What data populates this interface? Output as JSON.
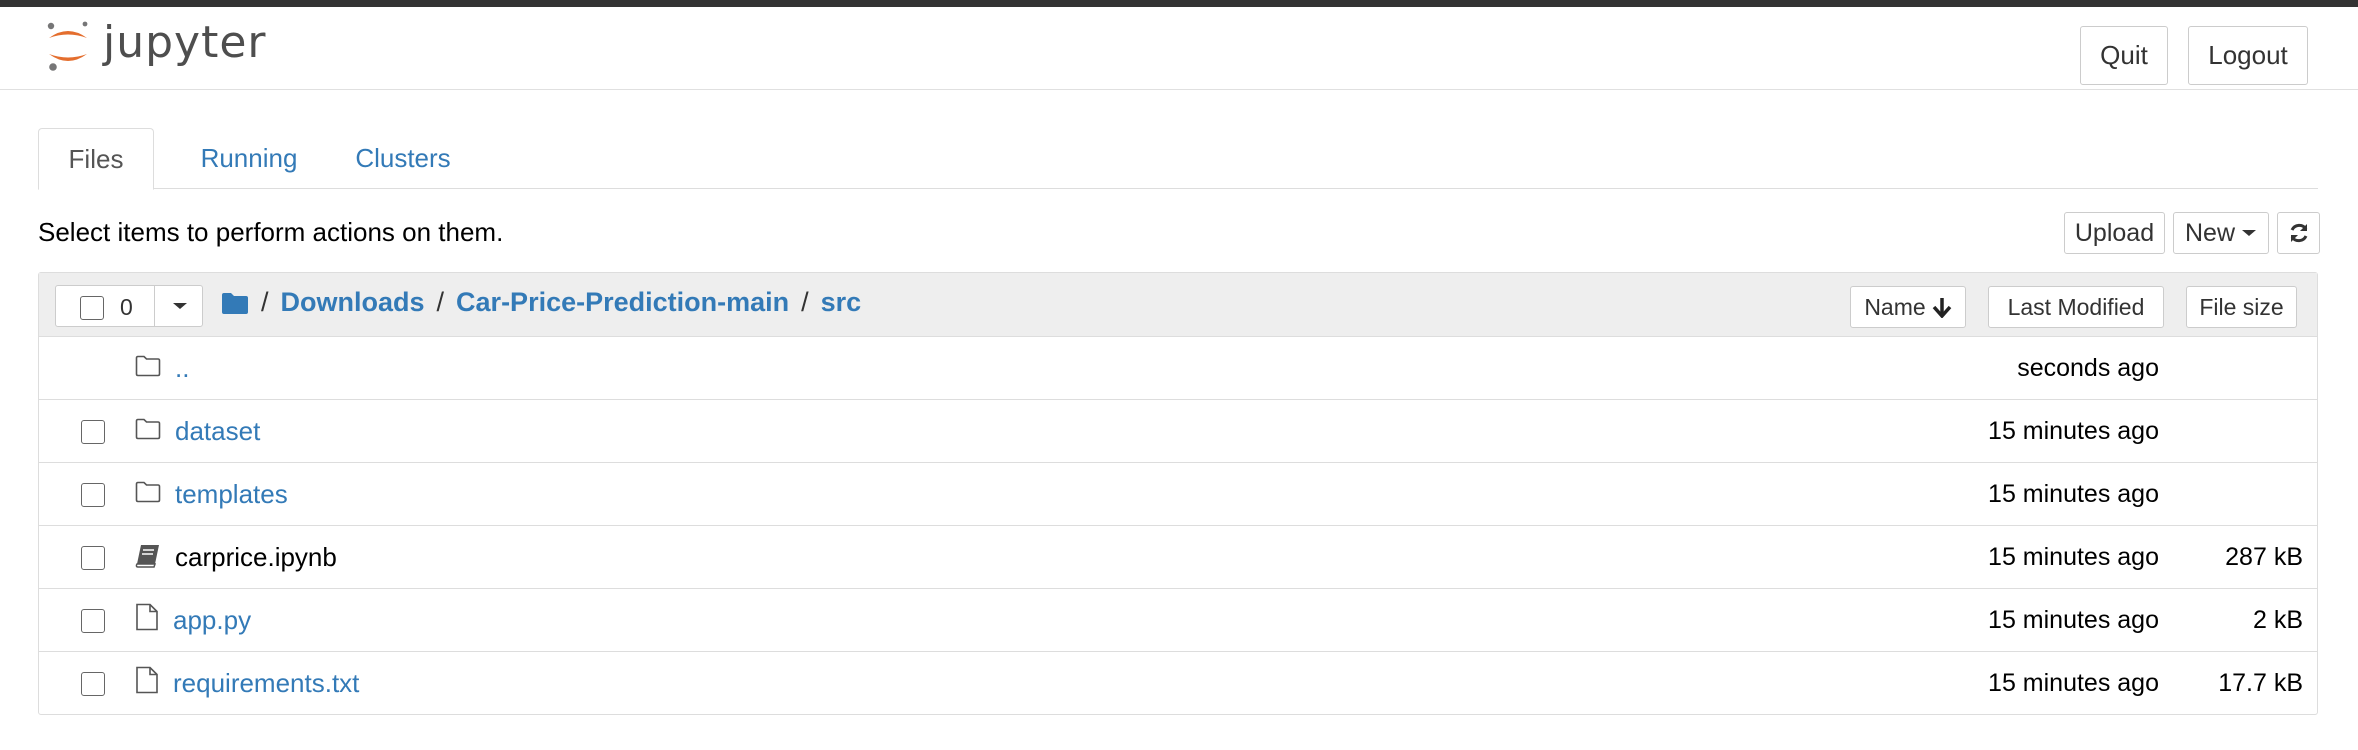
{
  "header": {
    "logo_text": "jupyter",
    "quit_label": "Quit",
    "logout_label": "Logout"
  },
  "tabs": [
    {
      "label": "Files",
      "active": true
    },
    {
      "label": "Running",
      "active": false
    },
    {
      "label": "Clusters",
      "active": false
    }
  ],
  "toolbar": {
    "hint": "Select items to perform actions on them.",
    "upload_label": "Upload",
    "new_label": "New",
    "refresh_icon": "refresh-icon"
  },
  "list_header": {
    "selected_count": "0",
    "breadcrumb": [
      "Downloads",
      "Car-Price-Prediction-main",
      "src"
    ],
    "sort_name": "Name",
    "sort_modified": "Last Modified",
    "sort_size": "File size"
  },
  "files": [
    {
      "name": "..",
      "type": "parent",
      "modified": "seconds ago",
      "size": "",
      "icon": "folder-icon"
    },
    {
      "name": "dataset",
      "type": "folder",
      "modified": "15 minutes ago",
      "size": "",
      "icon": "folder-icon"
    },
    {
      "name": "templates",
      "type": "folder",
      "modified": "15 minutes ago",
      "size": "",
      "icon": "folder-icon"
    },
    {
      "name": "carprice.ipynb",
      "type": "notebook",
      "modified": "15 minutes ago",
      "size": "287 kB",
      "icon": "notebook-icon"
    },
    {
      "name": "app.py",
      "type": "file",
      "modified": "15 minutes ago",
      "size": "2 kB",
      "icon": "file-icon"
    },
    {
      "name": "requirements.txt",
      "type": "file",
      "modified": "15 minutes ago",
      "size": "17.7 kB",
      "icon": "file-icon"
    }
  ],
  "colors": {
    "link": "#337ab7",
    "logo_orange": "#e46e2e",
    "topbar": "#333333"
  }
}
